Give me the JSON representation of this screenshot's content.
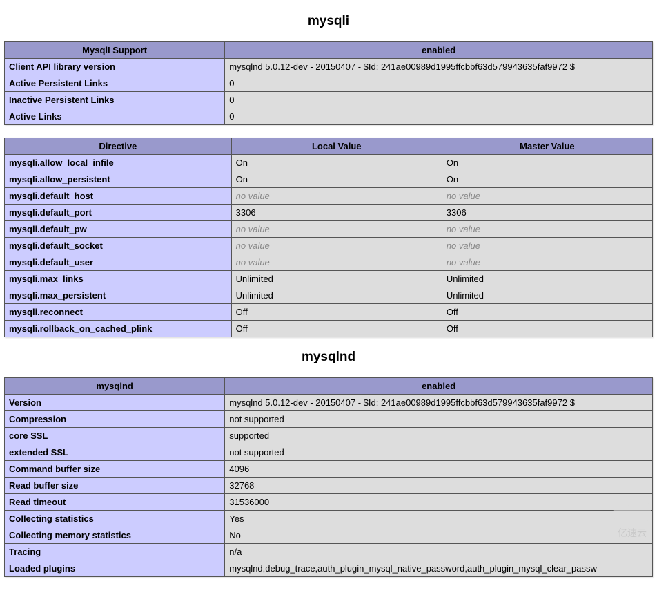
{
  "sections": [
    {
      "title": "mysqli",
      "tables": [
        {
          "headers": [
            "MysqlI Support",
            "enabled"
          ],
          "colwidths": [
            "34%",
            "66%"
          ],
          "rows": [
            [
              "Client API library version",
              "mysqlnd 5.0.12-dev - 20150407 - $Id: 241ae00989d1995ffcbbf63d579943635faf9972 $"
            ],
            [
              "Active Persistent Links",
              "0"
            ],
            [
              "Inactive Persistent Links",
              "0"
            ],
            [
              "Active Links",
              "0"
            ]
          ]
        },
        {
          "headers": [
            "Directive",
            "Local Value",
            "Master Value"
          ],
          "colwidths": [
            "35%",
            "32.5%",
            "32.5%"
          ],
          "rows": [
            [
              "mysqli.allow_local_infile",
              "On",
              "On"
            ],
            [
              "mysqli.allow_persistent",
              "On",
              "On"
            ],
            [
              "mysqli.default_host",
              "no value",
              "no value"
            ],
            [
              "mysqli.default_port",
              "3306",
              "3306"
            ],
            [
              "mysqli.default_pw",
              "no value",
              "no value"
            ],
            [
              "mysqli.default_socket",
              "no value",
              "no value"
            ],
            [
              "mysqli.default_user",
              "no value",
              "no value"
            ],
            [
              "mysqli.max_links",
              "Unlimited",
              "Unlimited"
            ],
            [
              "mysqli.max_persistent",
              "Unlimited",
              "Unlimited"
            ],
            [
              "mysqli.reconnect",
              "Off",
              "Off"
            ],
            [
              "mysqli.rollback_on_cached_plink",
              "Off",
              "Off"
            ]
          ]
        }
      ]
    },
    {
      "title": "mysqlnd",
      "tables": [
        {
          "headers": [
            "mysqlnd",
            "enabled"
          ],
          "colwidths": [
            "34%",
            "66%"
          ],
          "rows": [
            [
              "Version",
              "mysqlnd 5.0.12-dev - 20150407 - $Id: 241ae00989d1995ffcbbf63d579943635faf9972 $"
            ],
            [
              "Compression",
              "not supported"
            ],
            [
              "core SSL",
              "supported"
            ],
            [
              "extended SSL",
              "not supported"
            ],
            [
              "Command buffer size",
              "4096"
            ],
            [
              "Read buffer size",
              "32768"
            ],
            [
              "Read timeout",
              "31536000"
            ],
            [
              "Collecting statistics",
              "Yes"
            ],
            [
              "Collecting memory statistics",
              "No"
            ],
            [
              "Tracing",
              "n/a"
            ],
            [
              "Loaded plugins",
              "mysqlnd,debug_trace,auth_plugin_mysql_native_password,auth_plugin_mysql_clear_passw"
            ]
          ]
        }
      ]
    }
  ],
  "watermark": "亿速云",
  "no_value_text": "no value"
}
